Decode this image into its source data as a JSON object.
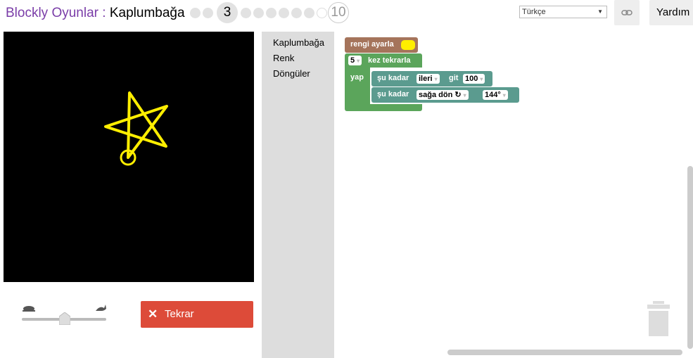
{
  "header": {
    "app_name": "Blockly Oyunlar",
    "separator": " : ",
    "game_name": "Kaplumbağa",
    "current_level": "3",
    "last_level": "10",
    "language": "Türkçe",
    "help_label": "Yardım"
  },
  "toolbox": {
    "categories": [
      "Kaplumbağa",
      "Renk",
      "Döngüler"
    ]
  },
  "blocks": {
    "set_colour_label": "rengi ayarla",
    "colour_value": "#ffee00",
    "repeat_count": "5",
    "repeat_label": "kez tekrarla",
    "do_label": "yap",
    "move_prefix": "şu kadar",
    "move_direction": "ileri",
    "move_label": "git",
    "move_amount": "100",
    "turn_prefix": "şu kadar",
    "turn_direction": "sağa dön ↻",
    "turn_angle": "144°"
  },
  "controls": {
    "reset_label": "Tekrar",
    "speed": 0.45
  },
  "colors": {
    "accent": "#7a3da8",
    "reset": "#dd4b39",
    "turtle_pen": "#ffee00",
    "loop_block": "#5ba55b",
    "colour_block": "#a5745b",
    "turtle_block": "#5b9b8f"
  }
}
